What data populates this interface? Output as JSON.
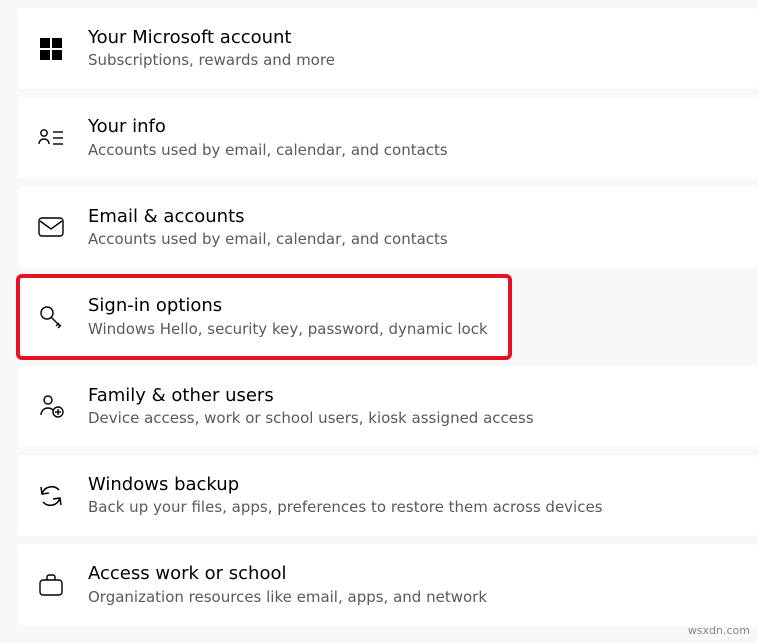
{
  "items": [
    {
      "title": "Your Microsoft account",
      "subtitle": "Subscriptions, rewards and more"
    },
    {
      "title": "Your info",
      "subtitle": "Accounts used by email, calendar, and contacts"
    },
    {
      "title": "Email & accounts",
      "subtitle": "Accounts used by email, calendar, and contacts"
    },
    {
      "title": "Sign-in options",
      "subtitle": "Windows Hello, security key, password, dynamic lock"
    },
    {
      "title": "Family & other users",
      "subtitle": "Device access, work or school users, kiosk assigned access"
    },
    {
      "title": "Windows backup",
      "subtitle": "Back up your files, apps, preferences to restore them across devices"
    },
    {
      "title": "Access work or school",
      "subtitle": "Organization resources like email, apps, and network"
    }
  ],
  "watermark": "wsxdn.com"
}
